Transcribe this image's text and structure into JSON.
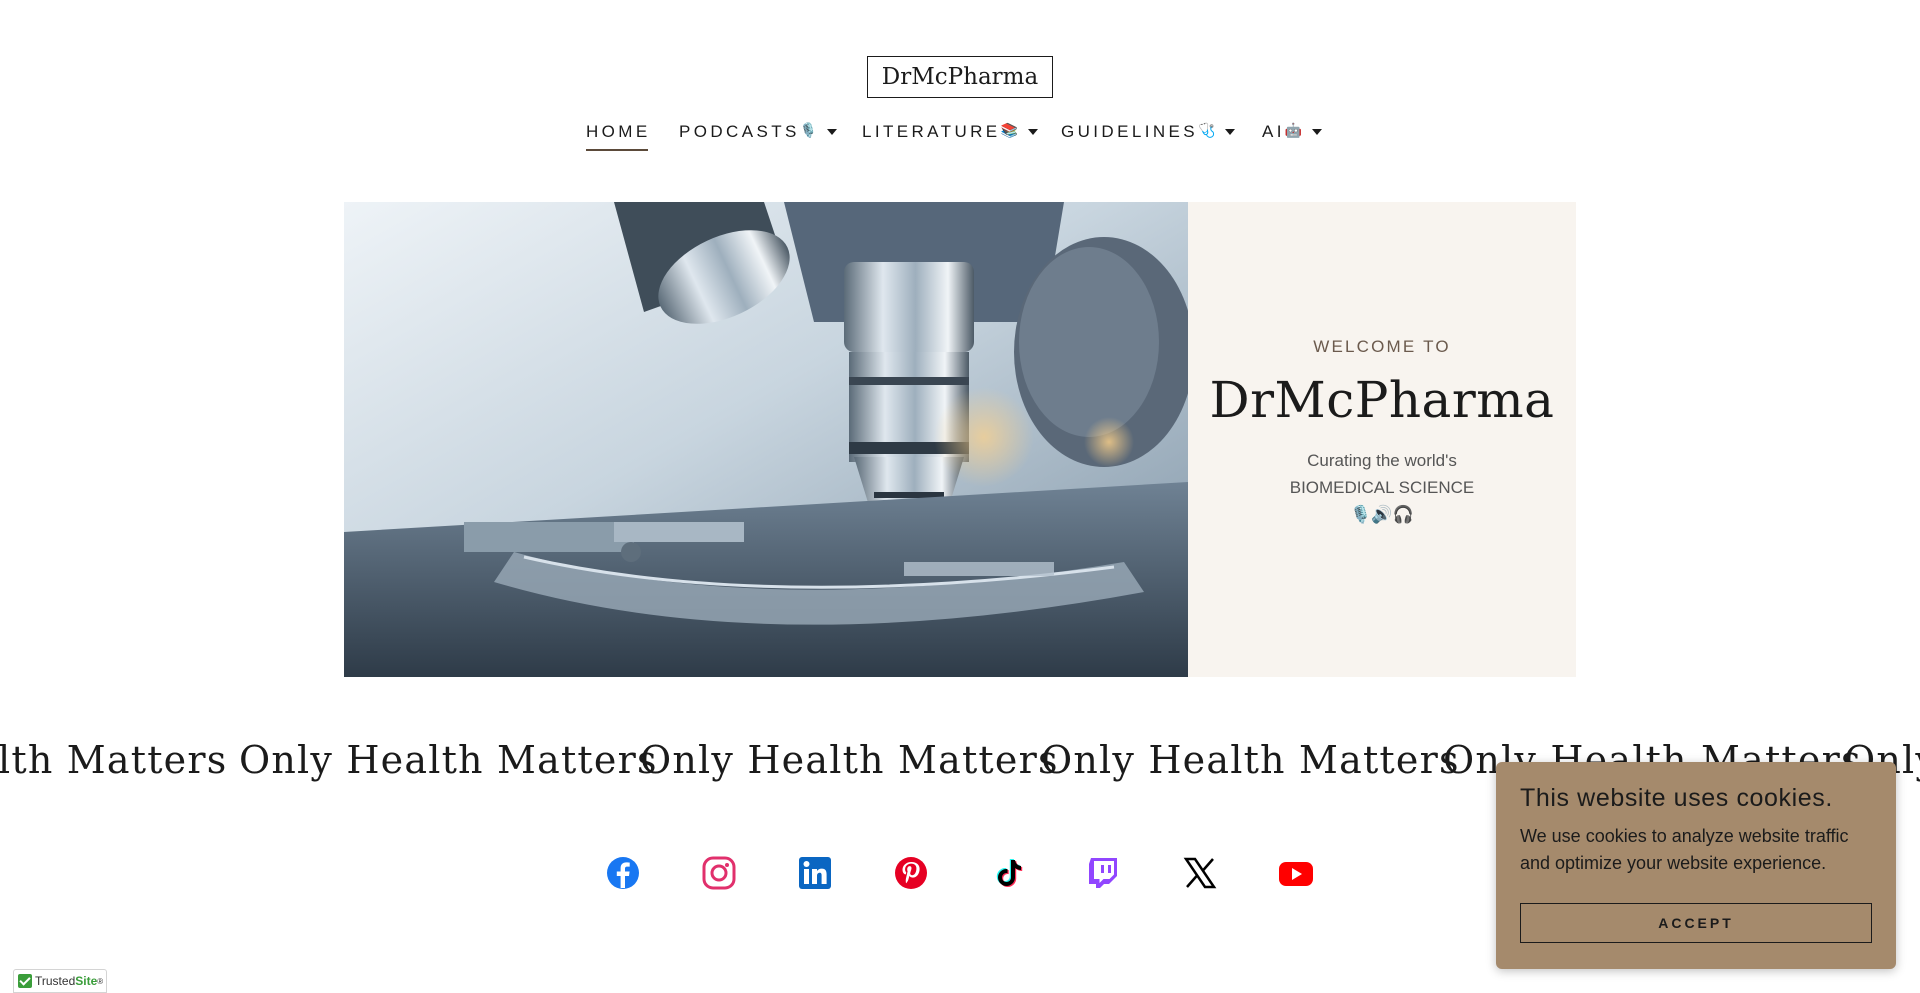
{
  "header": {
    "logo": "DrMcPharma"
  },
  "nav": {
    "items": [
      {
        "label": "HOME",
        "emoji": "",
        "dropdown": false,
        "active": true
      },
      {
        "label": "PODCASTS",
        "emoji": "🎙️",
        "dropdown": true,
        "active": false
      },
      {
        "label": "LITERATURE",
        "emoji": "📚",
        "dropdown": true,
        "active": false
      },
      {
        "label": "GUIDELINES",
        "emoji": "🩺",
        "dropdown": true,
        "active": false
      },
      {
        "label": "AI ",
        "emoji": "🤖",
        "dropdown": true,
        "active": false
      }
    ]
  },
  "hero": {
    "welcome": "WELCOME TO",
    "title": "DrMcPharma",
    "subtitle_line1": "Curating the world's",
    "subtitle_line2": "BIOMEDICAL SCIENCE",
    "subtitle_emojis": "🎙️🔊🎧"
  },
  "marquee": {
    "text": "Only Health Matters",
    "partial_left": "lth Matters"
  },
  "social": {
    "icons": [
      "facebook-icon",
      "instagram-icon",
      "linkedin-icon",
      "pinterest-icon",
      "tiktok-icon",
      "twitch-icon",
      "x-icon",
      "youtube-icon"
    ]
  },
  "cookie": {
    "title": "This website uses cookies.",
    "text": "We use cookies to analyze website traffic and optimize your website experience.",
    "accept_label": "ACCEPT"
  },
  "trusted_badge": {
    "prefix": "Trusted",
    "suffix": "Site",
    "tm": "®"
  },
  "colors": {
    "panel_bg": "#f8f4ef",
    "cookie_bg": "#a58a6c",
    "facebook": "#1877f2",
    "instagram": "#e1306c",
    "linkedin": "#0a66c2",
    "pinterest": "#e60023",
    "twitch": "#9146ff",
    "youtube": "#ff0000"
  }
}
